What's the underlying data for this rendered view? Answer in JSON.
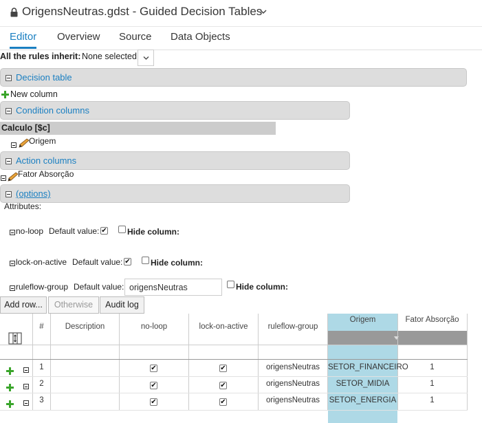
{
  "header": {
    "title": "OrigensNeutras.gdst - Guided Decision Tables",
    "lock_icon": "lock-icon",
    "chevron_icon": "chevron-down-icon"
  },
  "tabs": [
    {
      "label": "Editor",
      "active": true
    },
    {
      "label": "Overview",
      "active": false
    },
    {
      "label": "Source",
      "active": false
    },
    {
      "label": "Data Objects",
      "active": false
    }
  ],
  "inherit": {
    "label": "All the rules inherit:",
    "value": "None selected"
  },
  "sections": {
    "decision_table": "Decision table",
    "new_column": "New column",
    "condition_columns": "Condition columns",
    "condition_pattern": "Calculo [$c]",
    "condition_item": "Origem",
    "action_columns": "Action columns",
    "action_item": "Fator Absorção",
    "options": "(options)"
  },
  "attributes": {
    "title": "Attributes:",
    "default_value_label": "Default value:",
    "hide_column_label": "Hide column:",
    "items": [
      {
        "name": "no-loop",
        "default_checked": true,
        "hide": false
      },
      {
        "name": "lock-on-active",
        "default_checked": true,
        "hide": false
      },
      {
        "name": "ruleflow-group",
        "default_text": "origensNeutras",
        "hide": false
      }
    ]
  },
  "toolbar": {
    "add_row": "Add row...",
    "otherwise": "Otherwise",
    "audit_log": "Audit log"
  },
  "grid": {
    "columns": [
      "#",
      "Description",
      "no-loop",
      "lock-on-active",
      "ruleflow-group",
      "Origem",
      "Fator Absorção"
    ],
    "rows": [
      {
        "num": "1",
        "description": "",
        "no_loop": true,
        "lock_on_active": true,
        "ruleflow_group": "origensNeutras",
        "origem": "SETOR_FINANCEIRO",
        "fator": "1"
      },
      {
        "num": "2",
        "description": "",
        "no_loop": true,
        "lock_on_active": true,
        "ruleflow_group": "origensNeutras",
        "origem": "SETOR_MIDIA",
        "fator": "1"
      },
      {
        "num": "3",
        "description": "",
        "no_loop": true,
        "lock_on_active": true,
        "ruleflow_group": "origensNeutras",
        "origem": "SETOR_ENERGIA",
        "fator": "1"
      }
    ]
  },
  "colors": {
    "accent": "#1a7fc1",
    "section_bg": "#dddddd",
    "origem_header": "#aed9e6",
    "plus_green": "#3aa52b"
  }
}
